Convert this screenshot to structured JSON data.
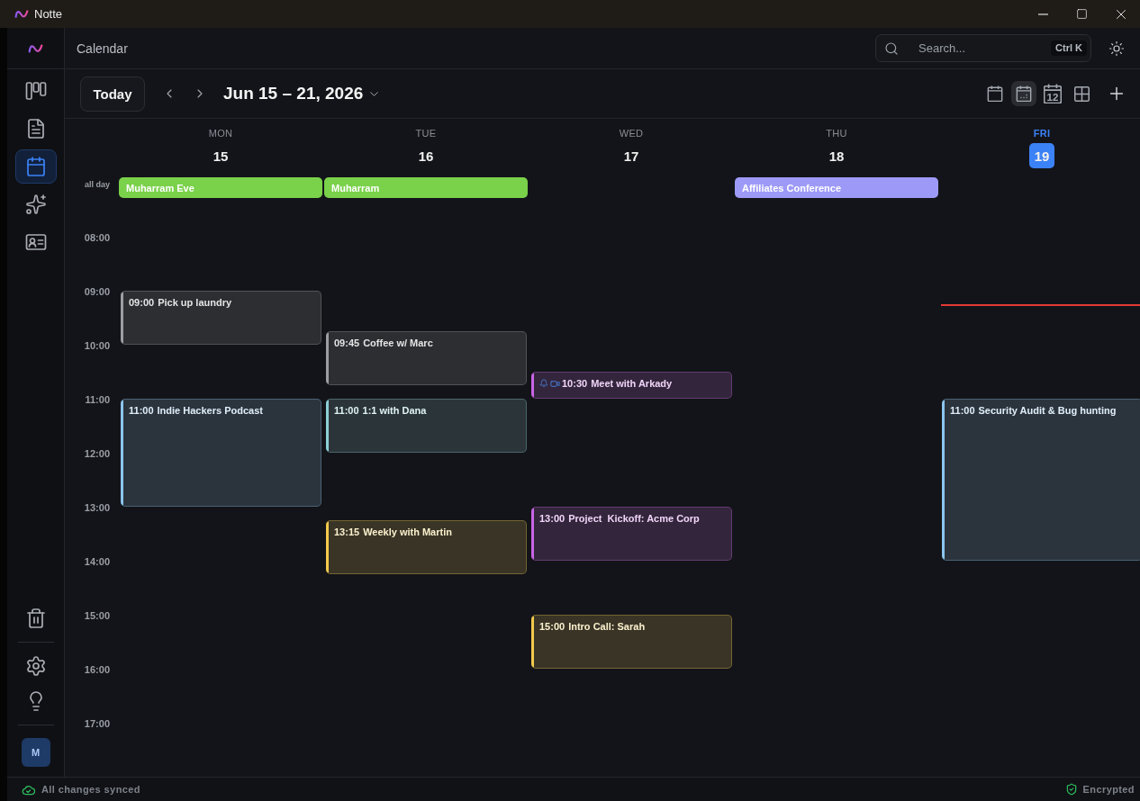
{
  "window": {
    "title": "Notte"
  },
  "sidebar": {
    "items": [
      {
        "kind": "board",
        "selected": false
      },
      {
        "kind": "notes",
        "selected": false
      },
      {
        "kind": "calendar",
        "selected": true
      },
      {
        "kind": "ai",
        "selected": false
      },
      {
        "kind": "contacts",
        "selected": false
      }
    ],
    "bottom_items": [
      {
        "kind": "trash"
      },
      {
        "kind": "settings"
      },
      {
        "kind": "tips"
      }
    ],
    "avatar": {
      "initial": "M"
    }
  },
  "header": {
    "title": "Calendar",
    "search": {
      "placeholder": "Search...",
      "shortcut": "Ctrl K"
    }
  },
  "toolbar": {
    "today_button": "Today",
    "range": "Jun 15 – 21, 2026",
    "views": [
      {
        "kind": "day",
        "selected": false
      },
      {
        "kind": "week",
        "selected": true
      },
      {
        "kind": "month",
        "label": "12",
        "selected": false
      },
      {
        "kind": "year",
        "selected": false
      }
    ]
  },
  "calendar": {
    "all_day_label": "all day",
    "hours": [
      "08:00",
      "09:00",
      "10:00",
      "11:00",
      "12:00",
      "13:00",
      "14:00",
      "15:00",
      "16:00",
      "17:00"
    ],
    "days": [
      {
        "weekday": "MON",
        "date": "15",
        "today": false,
        "all_day": [
          {
            "title": "Muharram Eve",
            "color": "#7ad14a"
          }
        ],
        "events": [
          {
            "time": "09:00",
            "title": "Pick up laundry",
            "kind": "hour",
            "color": "#9d9ea3",
            "reminder": false,
            "video": false
          },
          {
            "time": "11:00",
            "title": "Indie Hackers Podcast",
            "kind": "double",
            "color": "#8cc4ee",
            "reminder": false,
            "video": false
          }
        ]
      },
      {
        "weekday": "TUE",
        "date": "16",
        "today": false,
        "all_day": [
          {
            "title": "Muharram",
            "color": "#7ad14a"
          }
        ],
        "events": [
          {
            "time": "09:45",
            "title": "Coffee w/ Marc",
            "kind": "hour",
            "color": "#9d9ea3",
            "reminder": false,
            "video": false
          },
          {
            "time": "11:00",
            "title": "1:1 with Dana",
            "kind": "hour",
            "color": "#8ccfd6",
            "reminder": false,
            "video": false
          },
          {
            "time": "13:15",
            "title": "Weekly with Martin",
            "kind": "hour",
            "color": "#f2c94c",
            "reminder": false,
            "video": false
          }
        ]
      },
      {
        "weekday": "WED",
        "date": "17",
        "today": false,
        "events": [
          {
            "time": "10:30",
            "title": "Meet with Arkady",
            "kind": "half",
            "color": "#c964e6",
            "reminder": true,
            "video": true
          },
          {
            "time": "13:00",
            "title": "Project  Kickoff: Acme Corp",
            "kind": "hour",
            "color": "#c964e6",
            "reminder": false,
            "video": false
          },
          {
            "time": "15:00",
            "title": "Intro Call: Sarah",
            "kind": "hour",
            "color": "#f2c94c",
            "reminder": false,
            "video": false
          }
        ]
      },
      {
        "weekday": "THU",
        "date": "18",
        "today": false,
        "all_day": [
          {
            "title": "Affiliates Conference",
            "color": "#9d9af7"
          }
        ]
      },
      {
        "weekday": "FRI",
        "date": "19",
        "today": true,
        "now_line": {
          "level": 0.181
        },
        "events": [
          {
            "time": "11:00",
            "title": "Security Audit & Bug hunting",
            "kind": "triple",
            "color": "#8cc4ee",
            "reminder": false,
            "video": false
          }
        ]
      }
    ]
  },
  "status_bar": {
    "sync": "All changes synced",
    "security": "Encrypted"
  }
}
